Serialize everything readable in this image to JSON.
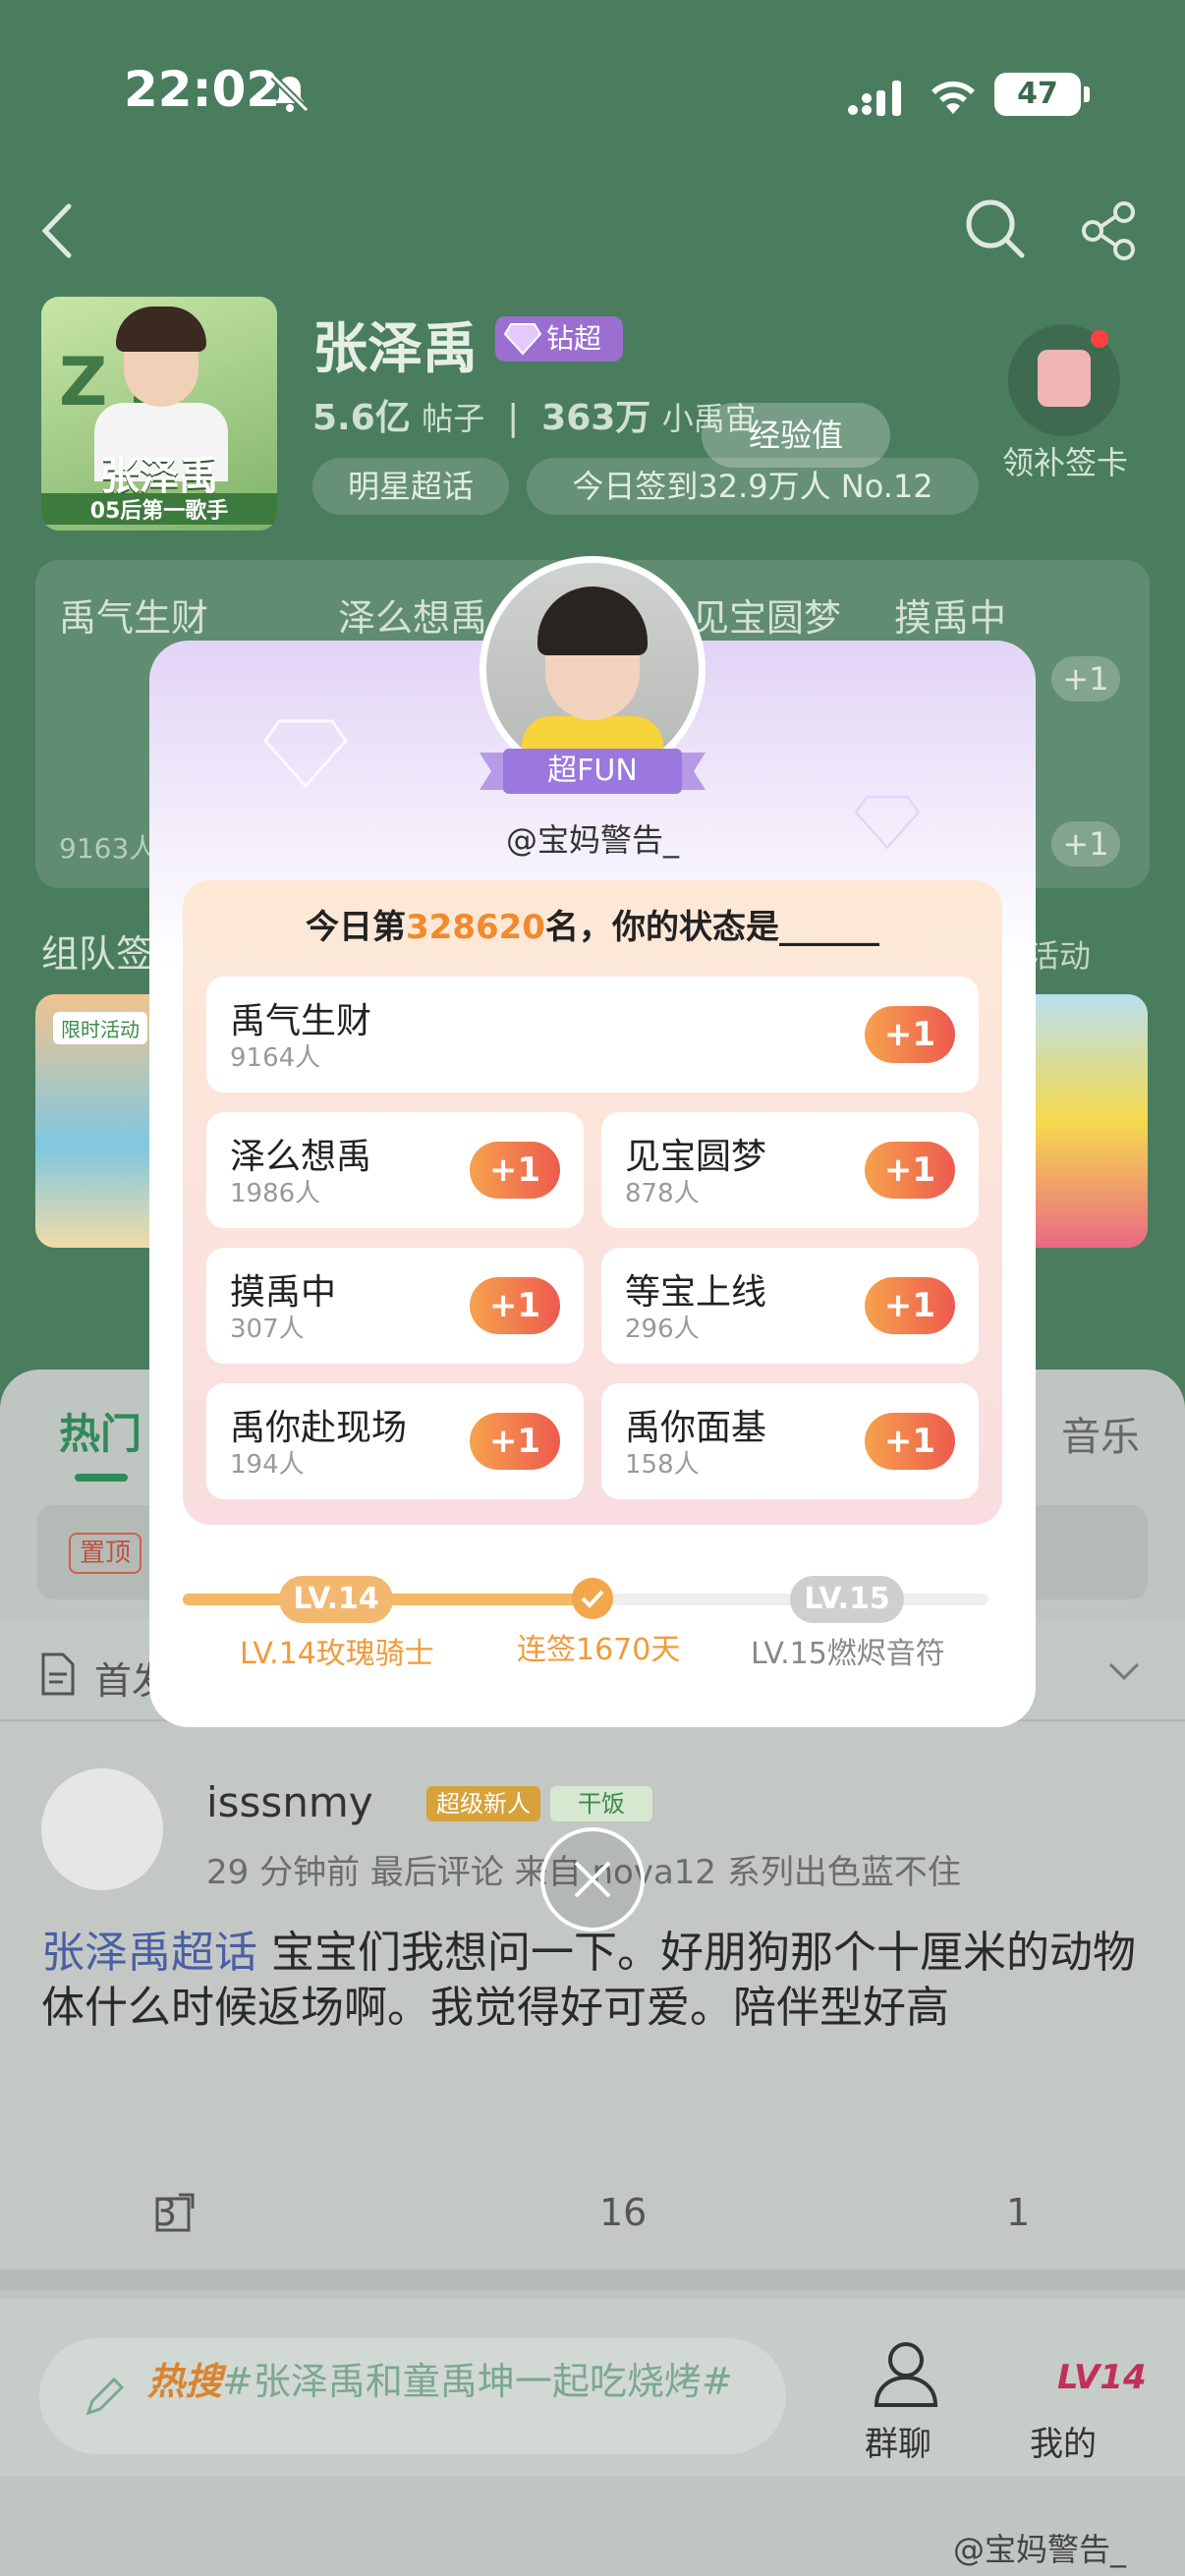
{
  "status_bar": {
    "time": "22:02",
    "battery": "47"
  },
  "community": {
    "title": "张泽禹",
    "vip_label": "钻超",
    "posts_count": "5.6亿",
    "posts_unit": "帖子",
    "fans_count": "363万",
    "fans_unit": "小禹宙",
    "cover_text": "张泽禹",
    "cover_sub": "05后第一歌手",
    "chip_star": "明星超话",
    "chip_checkin": "今日签到32.9万人 No.12",
    "exp_label": "经验值",
    "checkin_card": "领补签卡"
  },
  "bg_panel": {
    "items": [
      {
        "name": "禹气生财",
        "count": "9163人",
        "plus": "+1"
      },
      {
        "name": "泽么想禹",
        "plus": "+1"
      },
      {
        "name": "见宝圆梦",
        "plus": "+1"
      },
      {
        "name": "摸禹中",
        "plus": "+1"
      }
    ],
    "team_title": "组队签",
    "activity": "活动",
    "banner_tag": "限时活动"
  },
  "sheet": {
    "tab_hot": "热门",
    "tab_music": "音乐",
    "pin_badge": "置顶",
    "first_label": "首发"
  },
  "post": {
    "username": "isssnmy",
    "badge_new": "超级新人",
    "badge_eat": "干饭",
    "meta": "29 分钟前  最后评论  来自 nova12 系列出色蓝不住",
    "tag": "张泽禹超话",
    "text": " 宝宝们我想问一下。好朋狗那个十厘米的动物体什么时候返场啊。我觉得好可爱。陪伴型好高",
    "shares": "3",
    "comments": "16",
    "likes": "1"
  },
  "bottom": {
    "hot_label": "热搜",
    "hot_text": "#张泽禹和童禹坤一起吃烧烤#",
    "group_chat": "群聊",
    "mine": "我的",
    "mine_badge": "LV14",
    "watermark": "@宝妈警告_"
  },
  "modal": {
    "badge": "超FUN",
    "handle": "@宝妈警告_",
    "question_prefix": "今日第",
    "rank": "328620",
    "question_suffix": "名，你的状态是______",
    "options": [
      {
        "name": "禹气生财",
        "count": "9164人",
        "btn": "+1"
      },
      {
        "name": "泽么想禹",
        "count": "1986人",
        "btn": "+1"
      },
      {
        "name": "见宝圆梦",
        "count": "878人",
        "btn": "+1"
      },
      {
        "name": "摸禹中",
        "count": "307人",
        "btn": "+1"
      },
      {
        "name": "等宝上线",
        "count": "296人",
        "btn": "+1"
      },
      {
        "name": "禹你赴现场",
        "count": "194人",
        "btn": "+1"
      },
      {
        "name": "禹你面基",
        "count": "158人",
        "btn": "+1"
      }
    ],
    "level_current": "LV.14",
    "level_next": "LV.15",
    "level_current_name": "LV.14玫瑰骑士",
    "streak": "连签1670天",
    "level_next_name": "LV.15燃烬音符",
    "progress": 0.5
  },
  "colors": {
    "accent_green": "#2f8a5a",
    "orange": "#f08a2b",
    "purple": "#9a6fd0"
  }
}
